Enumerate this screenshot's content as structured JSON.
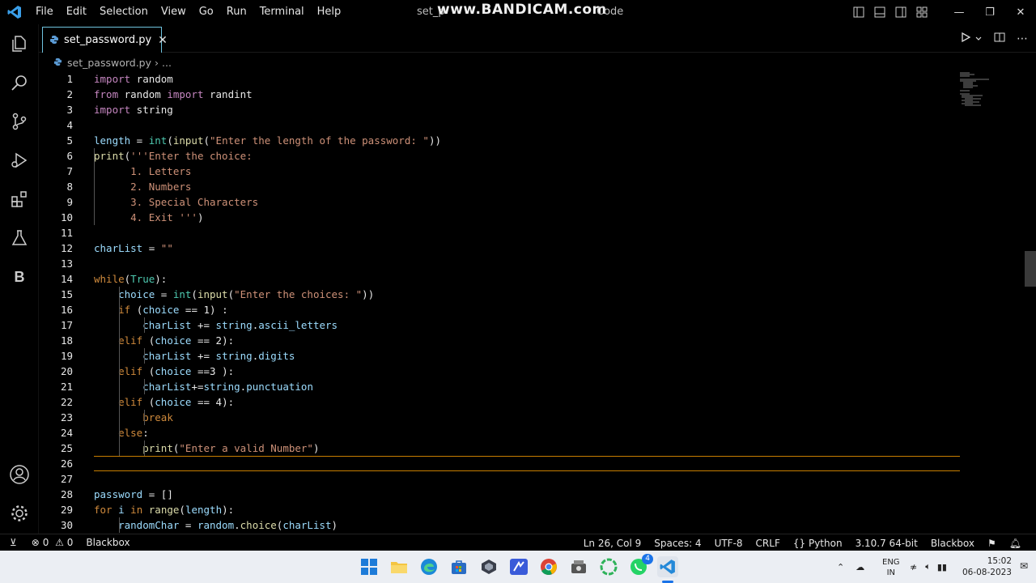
{
  "titlebar": {
    "menu": [
      "File",
      "Edit",
      "Selection",
      "View",
      "Go",
      "Run",
      "Terminal",
      "Help"
    ],
    "window_title": "set_p",
    "window_title_suffix": "Code",
    "watermark": "www.BANDICAM.com"
  },
  "tab": {
    "label": "set_password.py"
  },
  "breadcrumb": {
    "file": "set_password.py",
    "more": "..."
  },
  "editor": {
    "current_line": 26,
    "lines": [
      {
        "n": "1",
        "t": [
          [
            "kw",
            "import"
          ],
          [
            "op",
            " random"
          ]
        ]
      },
      {
        "n": "2",
        "t": [
          [
            "kw",
            "from"
          ],
          [
            "op",
            " random "
          ],
          [
            "kw",
            "import"
          ],
          [
            "op",
            " randint"
          ]
        ]
      },
      {
        "n": "3",
        "t": [
          [
            "kw",
            "import"
          ],
          [
            "op",
            " string"
          ]
        ]
      },
      {
        "n": "4",
        "t": []
      },
      {
        "n": "5",
        "t": [
          [
            "var",
            "length"
          ],
          [
            "op",
            " = "
          ],
          [
            "bi",
            "int"
          ],
          [
            "op",
            "("
          ],
          [
            "fn",
            "input"
          ],
          [
            "op",
            "("
          ],
          [
            "str",
            "\"Enter the length of the password: \""
          ],
          [
            "op",
            "))"
          ]
        ]
      },
      {
        "n": "6",
        "t": [
          [
            "fn",
            "print"
          ],
          [
            "op",
            "("
          ],
          [
            "str",
            "'''Enter the choice:"
          ]
        ]
      },
      {
        "n": "7",
        "t": [
          [
            "str",
            "      1. Letters"
          ]
        ]
      },
      {
        "n": "8",
        "t": [
          [
            "str",
            "      2. Numbers"
          ]
        ]
      },
      {
        "n": "9",
        "t": [
          [
            "str",
            "      3. Special Characters"
          ]
        ]
      },
      {
        "n": "10",
        "t": [
          [
            "str",
            "      4. Exit '''"
          ],
          [
            "op",
            ")"
          ]
        ]
      },
      {
        "n": "11",
        "t": []
      },
      {
        "n": "12",
        "t": [
          [
            "var",
            "charList"
          ],
          [
            "op",
            " = "
          ],
          [
            "str",
            "\"\""
          ]
        ]
      },
      {
        "n": "13",
        "t": []
      },
      {
        "n": "14",
        "t": [
          [
            "kw2",
            "while"
          ],
          [
            "op",
            "("
          ],
          [
            "bi",
            "True"
          ],
          [
            "op",
            "):"
          ]
        ]
      },
      {
        "n": "15",
        "t": [
          [
            "op",
            "    "
          ],
          [
            "var",
            "choice"
          ],
          [
            "op",
            " = "
          ],
          [
            "bi",
            "int"
          ],
          [
            "op",
            "("
          ],
          [
            "fn",
            "input"
          ],
          [
            "op",
            "("
          ],
          [
            "str",
            "\"Enter the choices: \""
          ],
          [
            "op",
            "))"
          ]
        ]
      },
      {
        "n": "16",
        "t": [
          [
            "op",
            "    "
          ],
          [
            "kw2",
            "if"
          ],
          [
            "op",
            " ("
          ],
          [
            "var",
            "choice"
          ],
          [
            "op",
            " == "
          ],
          [
            "num",
            "1"
          ],
          [
            "op",
            ") :"
          ]
        ]
      },
      {
        "n": "17",
        "t": [
          [
            "op",
            "        "
          ],
          [
            "var",
            "charList"
          ],
          [
            "op",
            " += "
          ],
          [
            "var",
            "string"
          ],
          [
            "op",
            "."
          ],
          [
            "var",
            "ascii_letters"
          ]
        ]
      },
      {
        "n": "18",
        "t": [
          [
            "op",
            "    "
          ],
          [
            "kw2",
            "elif"
          ],
          [
            "op",
            " ("
          ],
          [
            "var",
            "choice"
          ],
          [
            "op",
            " == "
          ],
          [
            "num",
            "2"
          ],
          [
            "op",
            "):"
          ]
        ]
      },
      {
        "n": "19",
        "t": [
          [
            "op",
            "        "
          ],
          [
            "var",
            "charList"
          ],
          [
            "op",
            " += "
          ],
          [
            "var",
            "string"
          ],
          [
            "op",
            "."
          ],
          [
            "var",
            "digits"
          ]
        ]
      },
      {
        "n": "20",
        "t": [
          [
            "op",
            "    "
          ],
          [
            "kw2",
            "elif"
          ],
          [
            "op",
            " ("
          ],
          [
            "var",
            "choice"
          ],
          [
            "op",
            " =="
          ],
          [
            "num",
            "3"
          ],
          [
            "op",
            " ):"
          ]
        ]
      },
      {
        "n": "21",
        "t": [
          [
            "op",
            "        "
          ],
          [
            "var",
            "charList"
          ],
          [
            "op",
            "+="
          ],
          [
            "var",
            "string"
          ],
          [
            "op",
            "."
          ],
          [
            "var",
            "punctuation"
          ]
        ]
      },
      {
        "n": "22",
        "t": [
          [
            "op",
            "    "
          ],
          [
            "kw2",
            "elif"
          ],
          [
            "op",
            " ("
          ],
          [
            "var",
            "choice"
          ],
          [
            "op",
            " == "
          ],
          [
            "num",
            "4"
          ],
          [
            "op",
            "):"
          ]
        ]
      },
      {
        "n": "23",
        "t": [
          [
            "op",
            "        "
          ],
          [
            "kw2",
            "break"
          ]
        ]
      },
      {
        "n": "24",
        "t": [
          [
            "op",
            "    "
          ],
          [
            "kw2",
            "else"
          ],
          [
            "op",
            ":"
          ]
        ]
      },
      {
        "n": "25",
        "t": [
          [
            "op",
            "        "
          ],
          [
            "fn",
            "print"
          ],
          [
            "op",
            "("
          ],
          [
            "str",
            "\"Enter a valid Number\""
          ],
          [
            "op",
            ")"
          ]
        ]
      },
      {
        "n": "26",
        "t": []
      },
      {
        "n": "27",
        "t": []
      },
      {
        "n": "28",
        "t": [
          [
            "var",
            "password"
          ],
          [
            "op",
            " = []"
          ]
        ]
      },
      {
        "n": "29",
        "t": [
          [
            "kw2",
            "for"
          ],
          [
            "op",
            " "
          ],
          [
            "var",
            "i"
          ],
          [
            "op",
            " "
          ],
          [
            "kw2",
            "in"
          ],
          [
            "op",
            " "
          ],
          [
            "fn",
            "range"
          ],
          [
            "op",
            "("
          ],
          [
            "var",
            "length"
          ],
          [
            "op",
            "):"
          ]
        ]
      },
      {
        "n": "30",
        "t": [
          [
            "op",
            "    "
          ],
          [
            "var",
            "randomChar"
          ],
          [
            "op",
            " = "
          ],
          [
            "var",
            "random"
          ],
          [
            "op",
            "."
          ],
          [
            "fn",
            "choice"
          ],
          [
            "op",
            "("
          ],
          [
            "var",
            "charList"
          ],
          [
            "op",
            ")"
          ]
        ]
      }
    ]
  },
  "statusbar": {
    "errors": "0",
    "warnings": "0",
    "blackbox_left": "Blackbox",
    "position": "Ln 26, Col 9",
    "spaces": "Spaces: 4",
    "encoding": "UTF-8",
    "eol": "CRLF",
    "language": "Python",
    "interpreter": "3.10.7 64-bit",
    "blackbox_right": "Blackbox"
  },
  "taskbar": {
    "lang_top": "ENG",
    "lang_bottom": "IN",
    "time": "15:02",
    "date": "06-08-2023",
    "whatsapp_badge": "4"
  },
  "colors": {
    "accent": "#0078d4",
    "keyword": "#c586c0",
    "control": "#cf8a3c",
    "function": "#dcdcaa",
    "string": "#ce9178",
    "variable": "#9cdcfe",
    "builtin": "#4ec9b0"
  }
}
